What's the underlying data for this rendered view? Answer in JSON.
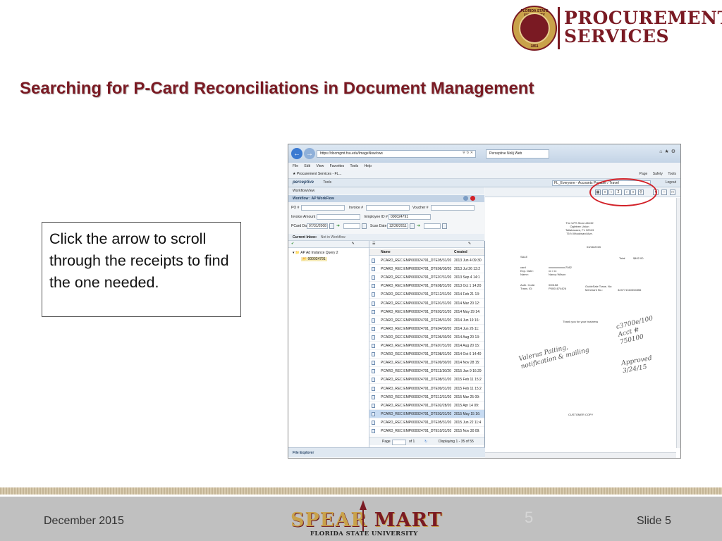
{
  "header": {
    "seal_text": "FLORIDA STATE UNIVERSITY",
    "seal_year": "1851",
    "logo_line1": "PROCUREMENT",
    "logo_line2": "SERVICES"
  },
  "slide_title": "Searching for P-Card Reconciliations in Document Management",
  "callout_text": "Click the arrow to scroll through the receipts to find the one needed.",
  "browser": {
    "url": "https://docmgmt.fsu.edu/ImageNow/ows",
    "tab_label": "Perceptive Nolij Web",
    "menu_items": [
      "File",
      "Edit",
      "View",
      "Favorites",
      "Tools",
      "Help"
    ],
    "favorite": "Procurement Services - FL...",
    "command_items": [
      "Page",
      "Safety",
      "Tools"
    ],
    "app_brand": "perceptive",
    "app_tools": "Tools",
    "department": "FL_Everyone - Accounts Payable / Travel",
    "logout": "Logout",
    "workflow_menu": "WorkflowView",
    "workflow_header": "Workflow : AP WorkFlow",
    "form": {
      "po_label": "PO #",
      "invoice_label": "Invoice #",
      "voucher_label": "Voucher #",
      "invoice_amount_label": "Invoice Amount",
      "employee_id_label": "Employee ID #",
      "employee_id_value": "000024791",
      "pcard_date_label": "PCard Date",
      "pcard_date_value": "07/31/2008",
      "scan_date_label": "Scan Date",
      "scan_date_value": "12/26/2011"
    },
    "current_inbox_label": "Current Inbox:",
    "current_inbox_value": "Not in Workflow",
    "tree": {
      "root": "AP Ad Instance Query 2",
      "child": "000024791"
    },
    "columns": {
      "name": "Name",
      "created": "Created"
    },
    "rows": [
      {
        "name": "PCARD_REC EMP000024791_DTE05/31/2013",
        "created": "2013 Jun 4 09:30"
      },
      {
        "name": "PCARD_REC EMP000024791_DTE06/30/2013",
        "created": "2013 Jul 26 13:2"
      },
      {
        "name": "PCARD_REC EMP000024791_DTE07/31/2013",
        "created": "2013 Sep 4 14:1"
      },
      {
        "name": "PCARD_REC EMP000024791_DTE08/31/2013",
        "created": "2013 Oct 1 14:20"
      },
      {
        "name": "PCARD_REC EMP000024791_DTE12/31/2013",
        "created": "2014 Feb 21 13:"
      },
      {
        "name": "PCARD_REC EMP000024791_DTE01/31/2014",
        "created": "2014 Mar 20 12:"
      },
      {
        "name": "PCARD_REC EMP000024791_DTE03/31/2014",
        "created": "2014 May 29 14:"
      },
      {
        "name": "PCARD_REC EMP000024791_DTE05/31/2014",
        "created": "2014 Jun 19 16:"
      },
      {
        "name": "PCARD_REC EMP000024791_DTE04/30/2014",
        "created": "2014 Jun 26 11:"
      },
      {
        "name": "PCARD_REC EMP000024791_DTE06/30/2014",
        "created": "2014 Aug 20 13:"
      },
      {
        "name": "PCARD_REC EMP000024791_DTE07/31/2014",
        "created": "2014 Aug 20 15:"
      },
      {
        "name": "PCARD_REC EMP000024791_DTE08/31/2014",
        "created": "2014 Oct 6 14:40"
      },
      {
        "name": "PCARD_REC EMP000024791_DTE09/30/2014",
        "created": "2014 Nov 28 15:"
      },
      {
        "name": "PCARD_REC EMP000024791_DTE11/30/2014",
        "created": "2015 Jan 9 16:29"
      },
      {
        "name": "PCARD_REC EMP000024791_DTE08/31/2014",
        "created": "2015 Feb 11 15:2"
      },
      {
        "name": "PCARD_REC EMP000024791_DTE09/31/2014",
        "created": "2015 Feb 11 15:2"
      },
      {
        "name": "PCARD_REC EMP000024791_DTE12/31/2014",
        "created": "2015 Mar 25 09:"
      },
      {
        "name": "PCARD_REC EMP000024791_DTE02/28/2015",
        "created": "2015 Apr 14 09:"
      },
      {
        "name": "PCARD_REC EMP000024791_DTE03/31/2015",
        "created": "2015 May 15 16:"
      },
      {
        "name": "PCARD_REC EMP000024791_DTE05/31/2015",
        "created": "2015 Jun 22 11:4"
      },
      {
        "name": "PCARD_REC EMP000024791_DTE10/31/2015",
        "created": "2015 Nov 30 09:"
      }
    ],
    "pager": {
      "page_label": "Page",
      "of_label": "of 1",
      "display": "Displaying 1 - 35 of 55"
    },
    "file_explorer": "File Explorer",
    "viewer": {
      "page_value": "2",
      "store_lines": [
        "The UPS Store #6132",
        "Ogletree Union",
        "Tallahassee, FL 32313",
        "75 N Woodward Ave."
      ],
      "receipt_date": "03/16/2015",
      "sale": "SALE",
      "total_label": "Total",
      "total_value": "$402.00",
      "card_label": "card",
      "card_value": "xxxxxxxxxxxx7082",
      "exp_label": "Exp. Date:",
      "exp_value": "xx / xx",
      "name_label": "Name:",
      "name_value": "Nancy Wilson",
      "auth_label": "Auth. Code:",
      "auth_value": "000158",
      "trans_label": "Trans. ID:",
      "trans_value": "P5001674426",
      "guidesale_label": "GuideSale Trans. No:",
      "merchant_label": "Merchant No.:",
      "merchant_value": "324771310354556",
      "thanks": "Thank you for your business",
      "customer_copy": "CUSTOMER COPY",
      "handwriting_note": "Valerus Paiting, notification & mailing",
      "handwriting_code": "c3700e/100 Acct # 750100",
      "handwriting_approved": "Approved 3/24/15"
    }
  },
  "footer": {
    "date": "December 2015",
    "slide": "Slide 5",
    "slide_num_ghost": "5",
    "brand_spear": "SPEAR",
    "brand_mart": "MART",
    "brand_sub": "FLORIDA STATE UNIVERSITY"
  },
  "colors": {
    "garnet": "#7a1a23",
    "gold": "#c9a24a",
    "highlight_oval": "#d22128"
  }
}
